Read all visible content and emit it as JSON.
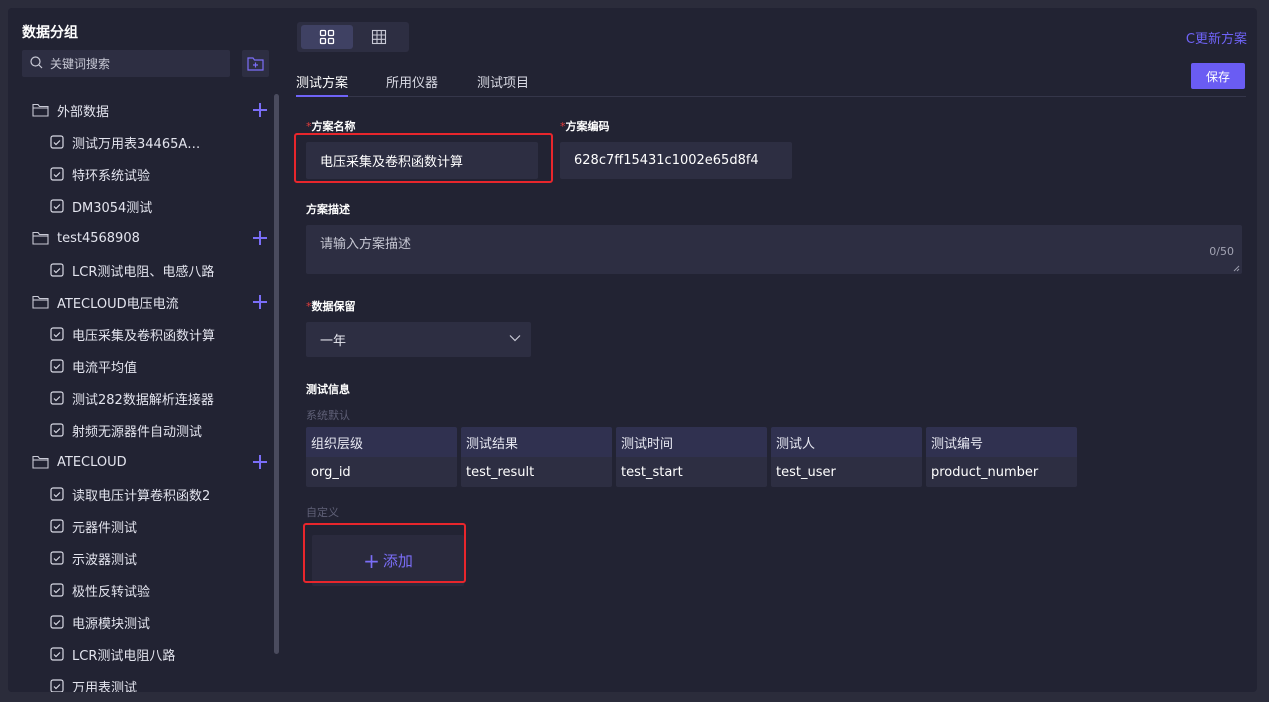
{
  "sidebar": {
    "title": "数据分组",
    "search_placeholder": "关键词搜索",
    "groups": [
      {
        "label": "外部数据",
        "items": [
          "测试万用表34465A…",
          "特环系统试验",
          "DM3054测试"
        ]
      },
      {
        "label": "test4568908",
        "items": [
          "LCR测试电阻、电感八路"
        ]
      },
      {
        "label": "ATECLOUD电压电流",
        "items": [
          "电压采集及卷积函数计算",
          "电流平均值",
          "测试282数据解析连接器",
          "射频无源器件自动测试"
        ]
      },
      {
        "label": "ATECLOUD",
        "items": [
          "读取电压计算卷积函数2",
          "元器件测试",
          "示波器测试",
          "极性反转试验",
          "电源模块测试",
          "LCR测试电阻八路",
          "万用表测试"
        ]
      }
    ]
  },
  "header": {
    "refresh_label": "C更新方案",
    "save_label": "保存",
    "tabs": [
      "测试方案",
      "所用仪器",
      "测试项目"
    ]
  },
  "form": {
    "name_label": "方案名称",
    "name_value": "电压采集及卷积函数计算",
    "code_label": "方案编码",
    "code_value": "628c7ff15431c1002e65d8f4",
    "desc_label": "方案描述",
    "desc_placeholder": "请输入方案描述",
    "desc_count": "0/50",
    "retention_label": "数据保留",
    "retention_value": "一年",
    "info_label": "测试信息",
    "system_default_label": "系统默认",
    "custom_label": "自定义",
    "add_label": "添加",
    "info_columns": [
      {
        "head": "组织层级",
        "value": "org_id"
      },
      {
        "head": "测试结果",
        "value": "test_result"
      },
      {
        "head": "测试时间",
        "value": "test_start"
      },
      {
        "head": "测试人",
        "value": "test_user"
      },
      {
        "head": "测试编号",
        "value": "product_number"
      }
    ]
  },
  "colors": {
    "accent": "#6a5cf3",
    "highlight": "#e8262c",
    "required": "#e23c3c"
  }
}
